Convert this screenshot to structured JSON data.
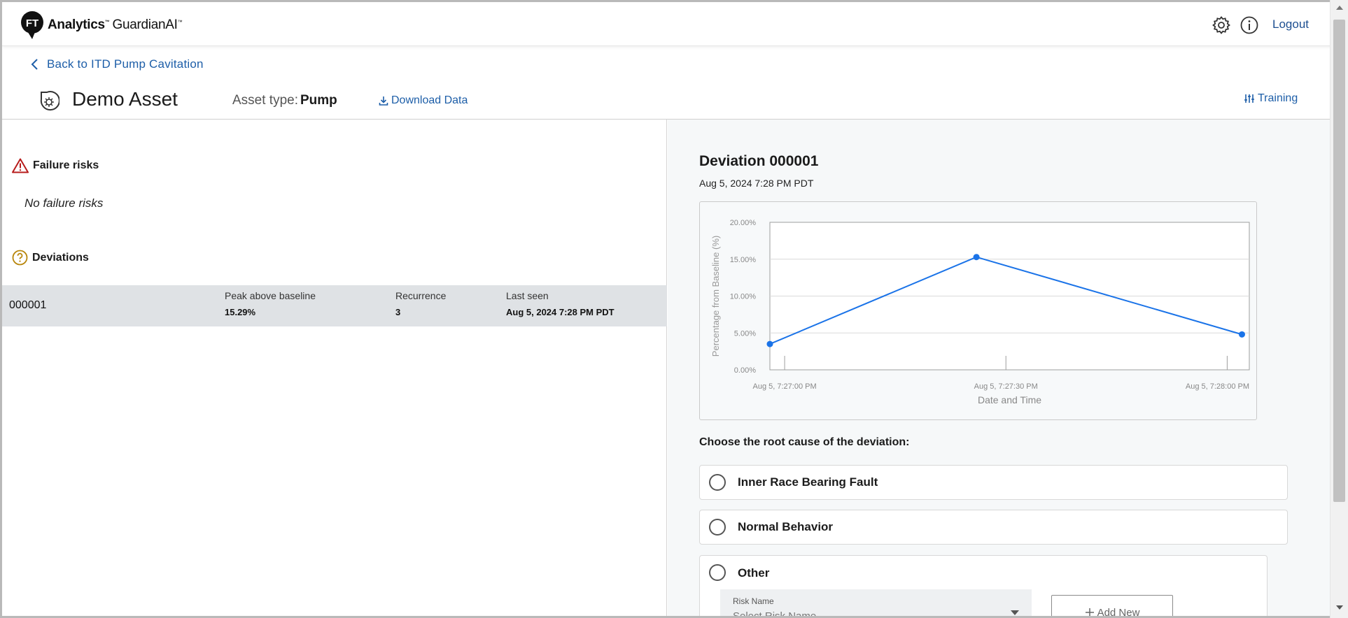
{
  "header": {
    "logo_badge": "FT",
    "logo_brand": "Analytics",
    "logo_product": "GuardianAI",
    "logo_tm": "™",
    "logout_label": "Logout",
    "icons": [
      "gear-icon",
      "info-icon"
    ]
  },
  "subheader": {
    "back_label": "Back to ITD Pump Cavitation",
    "asset_name": "Demo Asset",
    "asset_type_label": "Asset type:",
    "asset_type_value": "Pump",
    "download_label": "Download Data",
    "training_label": "Training"
  },
  "left": {
    "failure_risks_title": "Failure risks",
    "no_failure_risks": "No failure risks",
    "deviations_title": "Deviations",
    "deviation_row": {
      "id": "000001",
      "peak_label": "Peak above baseline",
      "peak_value": "15.29%",
      "recurrence_label": "Recurrence",
      "recurrence_value": "3",
      "last_seen_label": "Last seen",
      "last_seen_value": "Aug 5, 2024 7:28 PM PDT"
    }
  },
  "right": {
    "deviation_title": "Deviation 000001",
    "deviation_date": "Aug 5, 2024 7:28 PM PDT",
    "question": "Choose the root cause of the deviation:",
    "options": [
      {
        "label": "Inner Race Bearing Fault"
      },
      {
        "label": "Normal Behavior"
      },
      {
        "label": "Other"
      }
    ],
    "risk_select_label": "Risk Name",
    "risk_select_placeholder": "Select Risk Name",
    "add_new_label": "Add New",
    "add_new_icon": "plus-icon"
  },
  "colors": {
    "link": "#1d5ea8",
    "series": "#1a73e8",
    "row_highlight": "#dfe2e5",
    "warning": "#b71c1c",
    "question_icon": "#b8860b"
  },
  "chart_data": {
    "type": "line",
    "title": "",
    "xlabel": "Date and Time",
    "ylabel": "Percentage from Baseline (%)",
    "ylim": [
      0,
      20
    ],
    "yticks": [
      "0.00%",
      "5.00%",
      "10.00%",
      "15.00%",
      "20.00%"
    ],
    "xticks": [
      "Aug 5, 7:27:00 PM",
      "Aug 5, 7:27:30 PM",
      "Aug 5, 7:28:00 PM"
    ],
    "xrange_seconds": [
      -2,
      63
    ],
    "grid": true,
    "series": [
      {
        "x": [
          "Aug 5, 7:26:58 PM",
          "Aug 5, 7:27:26 PM",
          "Aug 5, 7:28:02 PM"
        ],
        "x_seconds": [
          -2,
          26,
          62
        ],
        "values": [
          3.5,
          15.29,
          4.8
        ]
      }
    ]
  }
}
